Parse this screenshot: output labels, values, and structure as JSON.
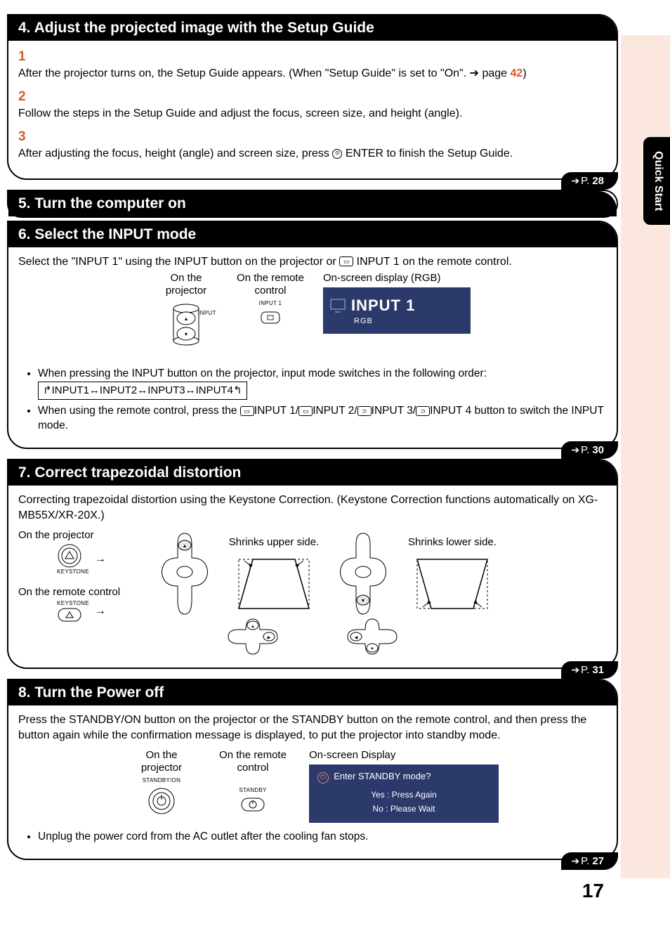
{
  "sideTab": "Quick Start",
  "pageNumber": "17",
  "sections": {
    "s4": {
      "header": "4.  Adjust the projected image with the Setup Guide",
      "steps": {
        "n1": "1",
        "t1a": "After the projector turns on, the Setup Guide appears. (When \"Setup Guide\" is set to \"On\". ➔ page ",
        "t1_ref": "42",
        "t1b": ")",
        "n2": "2",
        "t2": "Follow the steps in the Setup Guide and adjust the focus, screen size, and height (angle).",
        "n3": "3",
        "t3a": "After adjusting the focus, height (angle) and screen size, press ",
        "t3b": "ENTER to finish the Setup Guide."
      },
      "pageRef": "28"
    },
    "s5": {
      "header": "5. Turn the computer on"
    },
    "s6": {
      "header": "6. Select the INPUT mode",
      "intro_a": "Select the \"INPUT 1\" using the INPUT button on the projector or ",
      "intro_b": " INPUT 1 on the remote control.",
      "colLabels": {
        "proj": "On the projector",
        "remote": "On the remote control",
        "osd": "On-screen display (RGB)"
      },
      "projBtnLabel": "INPUT",
      "remoteBtnLabel": "INPUT 1",
      "osd": {
        "title": "INPUT 1",
        "sub": "RGB"
      },
      "bullets": {
        "b1": "When pressing the INPUT button on the projector, input mode switches in the following order:",
        "chain": "↱INPUT1↔INPUT2↔INPUT3↔INPUT4↰",
        "b2a": "When using the remote control, press the ",
        "b2b": "INPUT 1/",
        "b2c": "INPUT 2/",
        "b2d": "INPUT 3/",
        "b2e": "INPUT 4 button to switch the INPUT mode."
      },
      "pageRef": "30"
    },
    "s7": {
      "header": "7. Correct trapezoidal distortion",
      "intro": "Correcting trapezoidal distortion using the Keystone Correction. (Keystone Correction functions automatically on XG-MB55X/XR-20X.)",
      "labels": {
        "onProj": "On the projector",
        "onRemote": "On the remote control",
        "keystone": "KEYSTONE",
        "shrinksUpper": "Shrinks upper side.",
        "shrinksLower": "Shrinks lower side."
      },
      "pageRef": "31"
    },
    "s8": {
      "header": "8. Turn the Power off",
      "intro": "Press the STANDBY/ON button on the projector or the STANDBY button on the remote control, and then press the button again while the confirmation message is displayed, to put the projector into standby mode.",
      "colLabels": {
        "proj": "On the projector",
        "remote": "On the remote control",
        "osd": "On-screen Display"
      },
      "projBtnLabel": "STANDBY/ON",
      "remoteBtnLabel": "STANDBY",
      "osd": {
        "line1": "Enter STANDBY mode?",
        "line2": "Yes : Press Again",
        "line3": "No : Please Wait"
      },
      "bullet": "Unplug the power cord from the AC outlet after the cooling fan stops.",
      "pageRef": "27"
    }
  }
}
